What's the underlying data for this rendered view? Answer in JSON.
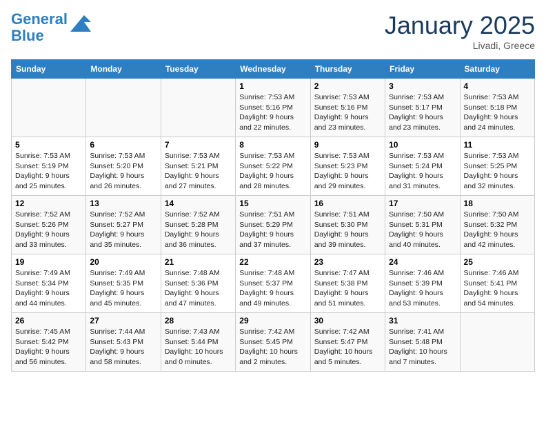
{
  "header": {
    "logo_line1": "General",
    "logo_line2": "Blue",
    "month_title": "January 2025",
    "location": "Livadi, Greece"
  },
  "days_of_week": [
    "Sunday",
    "Monday",
    "Tuesday",
    "Wednesday",
    "Thursday",
    "Friday",
    "Saturday"
  ],
  "weeks": [
    [
      {
        "day": "",
        "content": ""
      },
      {
        "day": "",
        "content": ""
      },
      {
        "day": "",
        "content": ""
      },
      {
        "day": "1",
        "content": "Sunrise: 7:53 AM\nSunset: 5:16 PM\nDaylight: 9 hours\nand 22 minutes."
      },
      {
        "day": "2",
        "content": "Sunrise: 7:53 AM\nSunset: 5:16 PM\nDaylight: 9 hours\nand 23 minutes."
      },
      {
        "day": "3",
        "content": "Sunrise: 7:53 AM\nSunset: 5:17 PM\nDaylight: 9 hours\nand 23 minutes."
      },
      {
        "day": "4",
        "content": "Sunrise: 7:53 AM\nSunset: 5:18 PM\nDaylight: 9 hours\nand 24 minutes."
      }
    ],
    [
      {
        "day": "5",
        "content": "Sunrise: 7:53 AM\nSunset: 5:19 PM\nDaylight: 9 hours\nand 25 minutes."
      },
      {
        "day": "6",
        "content": "Sunrise: 7:53 AM\nSunset: 5:20 PM\nDaylight: 9 hours\nand 26 minutes."
      },
      {
        "day": "7",
        "content": "Sunrise: 7:53 AM\nSunset: 5:21 PM\nDaylight: 9 hours\nand 27 minutes."
      },
      {
        "day": "8",
        "content": "Sunrise: 7:53 AM\nSunset: 5:22 PM\nDaylight: 9 hours\nand 28 minutes."
      },
      {
        "day": "9",
        "content": "Sunrise: 7:53 AM\nSunset: 5:23 PM\nDaylight: 9 hours\nand 29 minutes."
      },
      {
        "day": "10",
        "content": "Sunrise: 7:53 AM\nSunset: 5:24 PM\nDaylight: 9 hours\nand 31 minutes."
      },
      {
        "day": "11",
        "content": "Sunrise: 7:53 AM\nSunset: 5:25 PM\nDaylight: 9 hours\nand 32 minutes."
      }
    ],
    [
      {
        "day": "12",
        "content": "Sunrise: 7:52 AM\nSunset: 5:26 PM\nDaylight: 9 hours\nand 33 minutes."
      },
      {
        "day": "13",
        "content": "Sunrise: 7:52 AM\nSunset: 5:27 PM\nDaylight: 9 hours\nand 35 minutes."
      },
      {
        "day": "14",
        "content": "Sunrise: 7:52 AM\nSunset: 5:28 PM\nDaylight: 9 hours\nand 36 minutes."
      },
      {
        "day": "15",
        "content": "Sunrise: 7:51 AM\nSunset: 5:29 PM\nDaylight: 9 hours\nand 37 minutes."
      },
      {
        "day": "16",
        "content": "Sunrise: 7:51 AM\nSunset: 5:30 PM\nDaylight: 9 hours\nand 39 minutes."
      },
      {
        "day": "17",
        "content": "Sunrise: 7:50 AM\nSunset: 5:31 PM\nDaylight: 9 hours\nand 40 minutes."
      },
      {
        "day": "18",
        "content": "Sunrise: 7:50 AM\nSunset: 5:32 PM\nDaylight: 9 hours\nand 42 minutes."
      }
    ],
    [
      {
        "day": "19",
        "content": "Sunrise: 7:49 AM\nSunset: 5:34 PM\nDaylight: 9 hours\nand 44 minutes."
      },
      {
        "day": "20",
        "content": "Sunrise: 7:49 AM\nSunset: 5:35 PM\nDaylight: 9 hours\nand 45 minutes."
      },
      {
        "day": "21",
        "content": "Sunrise: 7:48 AM\nSunset: 5:36 PM\nDaylight: 9 hours\nand 47 minutes."
      },
      {
        "day": "22",
        "content": "Sunrise: 7:48 AM\nSunset: 5:37 PM\nDaylight: 9 hours\nand 49 minutes."
      },
      {
        "day": "23",
        "content": "Sunrise: 7:47 AM\nSunset: 5:38 PM\nDaylight: 9 hours\nand 51 minutes."
      },
      {
        "day": "24",
        "content": "Sunrise: 7:46 AM\nSunset: 5:39 PM\nDaylight: 9 hours\nand 53 minutes."
      },
      {
        "day": "25",
        "content": "Sunrise: 7:46 AM\nSunset: 5:41 PM\nDaylight: 9 hours\nand 54 minutes."
      }
    ],
    [
      {
        "day": "26",
        "content": "Sunrise: 7:45 AM\nSunset: 5:42 PM\nDaylight: 9 hours\nand 56 minutes."
      },
      {
        "day": "27",
        "content": "Sunrise: 7:44 AM\nSunset: 5:43 PM\nDaylight: 9 hours\nand 58 minutes."
      },
      {
        "day": "28",
        "content": "Sunrise: 7:43 AM\nSunset: 5:44 PM\nDaylight: 10 hours\nand 0 minutes."
      },
      {
        "day": "29",
        "content": "Sunrise: 7:42 AM\nSunset: 5:45 PM\nDaylight: 10 hours\nand 2 minutes."
      },
      {
        "day": "30",
        "content": "Sunrise: 7:42 AM\nSunset: 5:47 PM\nDaylight: 10 hours\nand 5 minutes."
      },
      {
        "day": "31",
        "content": "Sunrise: 7:41 AM\nSunset: 5:48 PM\nDaylight: 10 hours\nand 7 minutes."
      },
      {
        "day": "",
        "content": ""
      }
    ]
  ]
}
